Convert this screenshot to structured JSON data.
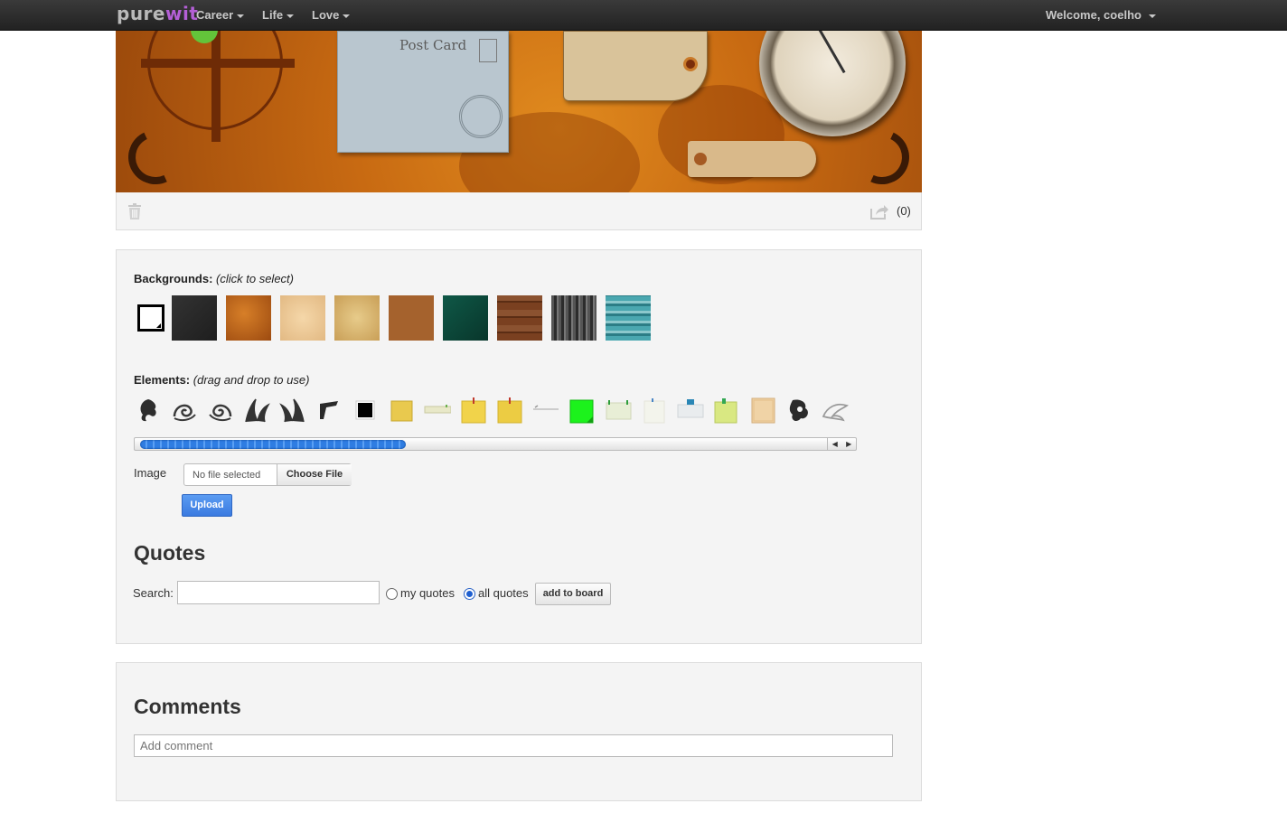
{
  "nav": {
    "logo_part1": "pure",
    "logo_part2": "wit",
    "menu": [
      {
        "label": "Career"
      },
      {
        "label": "Life"
      },
      {
        "label": "Love"
      }
    ],
    "welcome": "Welcome, coelho"
  },
  "board": {
    "postcard_title": "Post Card",
    "share_count": "(0)"
  },
  "backgrounds": {
    "label": "Backgrounds:",
    "hint": "(click to select)",
    "swatches": [
      "#2a2a2a",
      "#b7611c",
      "#e9c79b",
      "#d9b977",
      "#a5622d",
      "#0d4a3c",
      "#6b3a1e",
      "#3f3f3f",
      "#3f98a3"
    ]
  },
  "elements": {
    "label": "Elements:",
    "hint": "(drag and drop to use)"
  },
  "upload": {
    "label": "Image",
    "file_status": "No file selected",
    "choose_button": "Choose File",
    "upload_button": "Upload"
  },
  "quotes": {
    "heading": "Quotes",
    "search_label": "Search:",
    "search_value": "",
    "radio_my": "my quotes",
    "radio_all": "all quotes",
    "selected": "all quotes",
    "add_button": "add to board"
  },
  "comments": {
    "heading": "Comments",
    "placeholder": "Add comment"
  },
  "colors": {
    "nav_bg": "#2b2b2b",
    "accent_purple": "#b45fd6",
    "primary_blue": "#3a7ae0"
  }
}
